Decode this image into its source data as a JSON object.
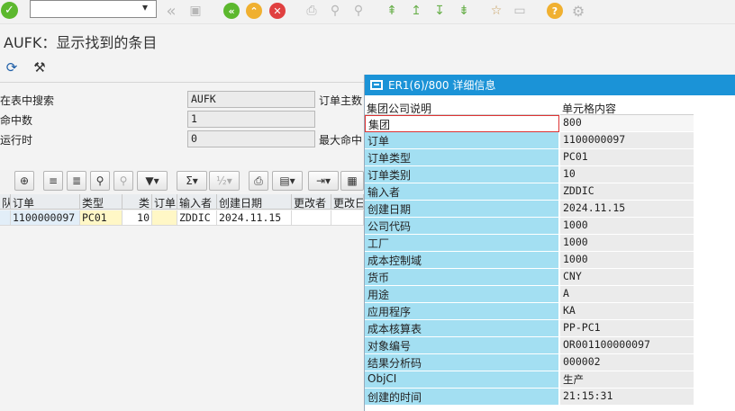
{
  "toolbar": {
    "command_field_value": "",
    "icons": [
      "enter-icon",
      "back-icon",
      "save-icon",
      "back-nav-icon",
      "exit-icon",
      "cancel-icon",
      "print-icon",
      "find-icon",
      "find-next-icon",
      "first-page-icon",
      "prev-page-icon",
      "next-page-icon",
      "last-page-icon",
      "new-session-icon",
      "shortcut-icon",
      "help-icon",
      "settings-icon"
    ]
  },
  "title": "AUFK：显示找到的条目",
  "info": {
    "row1_label": "在表中搜索",
    "row1_value": "AUFK",
    "row1_label2": "订单主数",
    "row2_label": "命中数",
    "row2_value": "1",
    "row3_label": "运行时",
    "row3_value": "0",
    "row3_label2": "最大命中"
  },
  "grid": {
    "headers": [
      "队",
      "订单",
      "类型",
      "类",
      "订单",
      "输入者",
      "创建日期",
      "更改者",
      "更改日"
    ],
    "row": [
      "",
      "1100000097",
      "PC01",
      "10",
      "",
      "ZDDIC",
      "2024.11.15",
      "",
      ""
    ]
  },
  "popup": {
    "title": "ER1(6)/800 详细信息",
    "col1": "集团公司说明",
    "col2": "单元格内容",
    "rows": [
      {
        "label": "集团",
        "value": "800"
      },
      {
        "label": "订单",
        "value": "1100000097"
      },
      {
        "label": "订单类型",
        "value": "PC01"
      },
      {
        "label": "订单类别",
        "value": "10"
      },
      {
        "label": "输入者",
        "value": "ZDDIC"
      },
      {
        "label": "创建日期",
        "value": "2024.11.15"
      },
      {
        "label": "公司代码",
        "value": "1000"
      },
      {
        "label": "工厂",
        "value": "1000"
      },
      {
        "label": "成本控制域",
        "value": "1000"
      },
      {
        "label": "货币",
        "value": "CNY"
      },
      {
        "label": "用途",
        "value": "A"
      },
      {
        "label": "应用程序",
        "value": "KA"
      },
      {
        "label": "成本核算表",
        "value": "PP-PC1"
      },
      {
        "label": "对象编号",
        "value": "OR001100000097"
      },
      {
        "label": "结果分析码",
        "value": "000002"
      },
      {
        "label": "ObjCI",
        "value": "生产"
      },
      {
        "label": "创建的时间",
        "value": "21:15:31"
      }
    ]
  },
  "colors": {
    "popup_title_bg": "#1b93d7",
    "label_bg": "#a3dff2",
    "ok_green": "#5cb82e"
  }
}
